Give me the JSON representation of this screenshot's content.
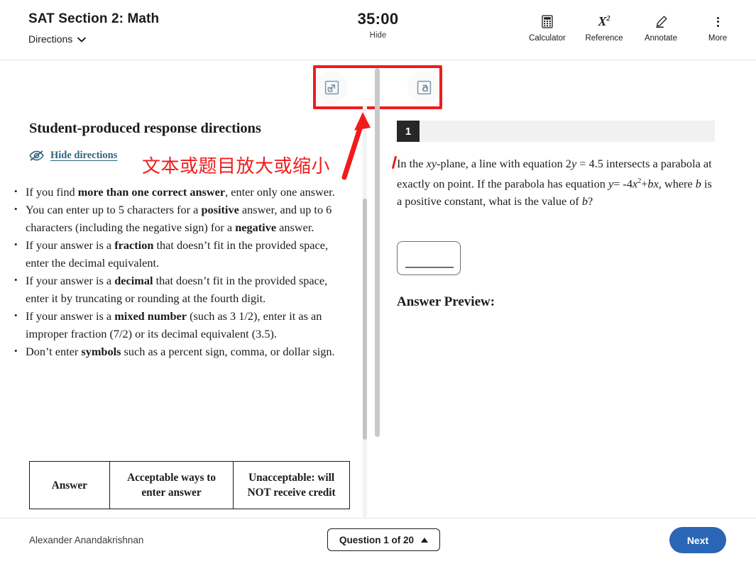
{
  "header": {
    "section_title": "SAT Section 2: Math",
    "directions_label": "Directions",
    "directions_icon": "chevron-down-icon",
    "timer": "35:00",
    "hide_label": "Hide",
    "tools": [
      {
        "label": "Calculator",
        "icon": "calculator-icon"
      },
      {
        "label": "Reference",
        "icon": "x-squared-icon"
      },
      {
        "label": "Annotate",
        "icon": "highlighter-pen-icon"
      },
      {
        "label": "More",
        "icon": "more-vertical-icon"
      }
    ]
  },
  "zoom_controls": {
    "zoom_in": {
      "name": "zoom-in-button",
      "icon": "expand-arrow-icon"
    },
    "zoom_out": {
      "name": "zoom-out-button",
      "icon": "collapse-arrow-icon"
    },
    "highlight_color": "#f21b1b"
  },
  "annotation": {
    "text": "文本或题目放大或缩小",
    "color": "#f21b1b",
    "arrow": "red-arrow-up-right"
  },
  "directions": {
    "heading": "Student-produced response directions",
    "hide_link": "Hide directions",
    "hide_icon": "eye-off-icon",
    "bullets": [
      {
        "parts": [
          {
            "t": "If you find ",
            "b": false
          },
          {
            "t": "more than one correct answer",
            "b": true
          },
          {
            "t": ", enter only one answer.",
            "b": false
          }
        ]
      },
      {
        "parts": [
          {
            "t": "You can enter up to 5 characters for a ",
            "b": false
          },
          {
            "t": "positive",
            "b": true
          },
          {
            "t": " answer, and up to 6 characters (including the negative sign) for a ",
            "b": false
          },
          {
            "t": "negative",
            "b": true
          },
          {
            "t": " answer.",
            "b": false
          }
        ]
      },
      {
        "parts": [
          {
            "t": " If your answer is a ",
            "b": false
          },
          {
            "t": "fraction",
            "b": true
          },
          {
            "t": " that doesn’t fit in the provided space, enter the decimal equivalent.",
            "b": false
          }
        ]
      },
      {
        "parts": [
          {
            "t": " If your answer is a ",
            "b": false
          },
          {
            "t": "decimal",
            "b": true
          },
          {
            "t": " that doesn’t fit in the provided space, enter it by truncating or rounding at the fourth digit.",
            "b": false
          }
        ]
      },
      {
        "parts": [
          {
            "t": " If your answer is a ",
            "b": false
          },
          {
            "t": "mixed number",
            "b": true
          },
          {
            "t": " (such as 3 1/2), enter it as an improper fraction (7/2) or its decimal equivalent (3.5).",
            "b": false
          }
        ]
      },
      {
        "parts": [
          {
            "t": "Don’t enter ",
            "b": false
          },
          {
            "t": "symbols",
            "b": true
          },
          {
            "t": " such as a percent sign, comma, or dollar sign.",
            "b": false
          }
        ]
      }
    ],
    "table_headers": [
      "Answer",
      "Acceptable ways to enter answer",
      "Unacceptable: will NOT receive credit"
    ]
  },
  "question": {
    "number": "1",
    "text_html": "In the <i>xy</i>-plane, a line with equation 2<i>y</i> = 4.5 intersects a parabola at exactly on point. If the parabola has equation <i>y</i>= -4<i>x</i><sup>2</sup>+<i>bx</i>, where <i>b</i> is a positive constant, what is the value of <i>b</i>?",
    "answer_value": "",
    "answer_preview_label": "Answer Preview:"
  },
  "footer": {
    "student_name": "Alexander Anandakrishnan",
    "question_nav": "Question 1 of 20",
    "question_nav_icon": "triangle-up-icon",
    "next_label": "Next",
    "next_color": "#2a66b5"
  }
}
